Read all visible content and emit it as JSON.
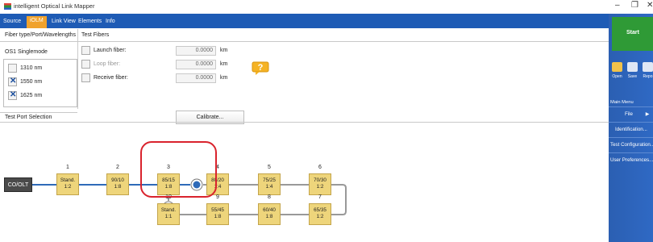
{
  "window": {
    "title": "intelligent Optical Link Mapper",
    "minimize": "–",
    "maximize": "❐",
    "close": "✕"
  },
  "tabs": [
    {
      "label": "Source"
    },
    {
      "label": "iOLM"
    },
    {
      "label": "Link View"
    },
    {
      "label": "Elements"
    },
    {
      "label": "Info"
    }
  ],
  "sections": {
    "fiber_type": "Fiber type/Port/Wavelengths",
    "test_fibers": "Test Fibers",
    "test_port": "Test Port Selection"
  },
  "fiber_mode": "OS1 Singlemode",
  "wavelengths": [
    {
      "label": "1310 nm",
      "checked": false
    },
    {
      "label": "1550 nm",
      "checked": true
    },
    {
      "label": "1625 nm",
      "checked": true
    }
  ],
  "test_fibers": [
    {
      "label": "Launch fiber:",
      "value": "0.0000",
      "unit": "km",
      "disabled": false
    },
    {
      "label": "Loop fiber:",
      "value": "0.0000",
      "unit": "km",
      "disabled": true
    },
    {
      "label": "Receive fiber:",
      "value": "0.0000",
      "unit": "km",
      "disabled": false
    }
  ],
  "calibrate_label": "Calibrate...",
  "help_icon": "question-mark-icon",
  "co_label": "CO/OLT",
  "nodes_top": [
    {
      "index": "1",
      "l1": "Stand.",
      "l2": "1:2"
    },
    {
      "index": "2",
      "l1": "90/10",
      "l2": "1:8"
    },
    {
      "index": "3",
      "l1": "85/15",
      "l2": "1:8"
    },
    {
      "index": "4",
      "l1": "80/20",
      "l2": "1:4"
    },
    {
      "index": "5",
      "l1": "75/25",
      "l2": "1:4"
    },
    {
      "index": "6",
      "l1": "70/30",
      "l2": "1:2"
    }
  ],
  "nodes_bottom": [
    {
      "index": "10",
      "l1": "Stand.",
      "l2": "1:1"
    },
    {
      "index": "9",
      "l1": "55/45",
      "l2": "1:8"
    },
    {
      "index": "8",
      "l1": "60/40",
      "l2": "1:8"
    },
    {
      "index": "7",
      "l1": "65/35",
      "l2": "1:2"
    }
  ],
  "selected_port_node": "3",
  "colors": {
    "tab_bar": "#1e5bb5",
    "tab_active": "#f0a22d",
    "node_fill": "#eed57b",
    "link_blue": "#2e6ab8",
    "highlight": "#d9232d",
    "start_green": "#2f9a36"
  },
  "right_panel": {
    "start_label": "Start",
    "tools": [
      {
        "label": "Open",
        "icon": "folder-icon"
      },
      {
        "label": "Save",
        "icon": "save-icon"
      },
      {
        "label": "Repo",
        "icon": "report-icon"
      }
    ],
    "main_menu_label": "Main Menu",
    "menu_items": [
      "File",
      "Identification...",
      "Test Configuration...",
      "User Preferences..."
    ],
    "file_arrow": "▶"
  }
}
